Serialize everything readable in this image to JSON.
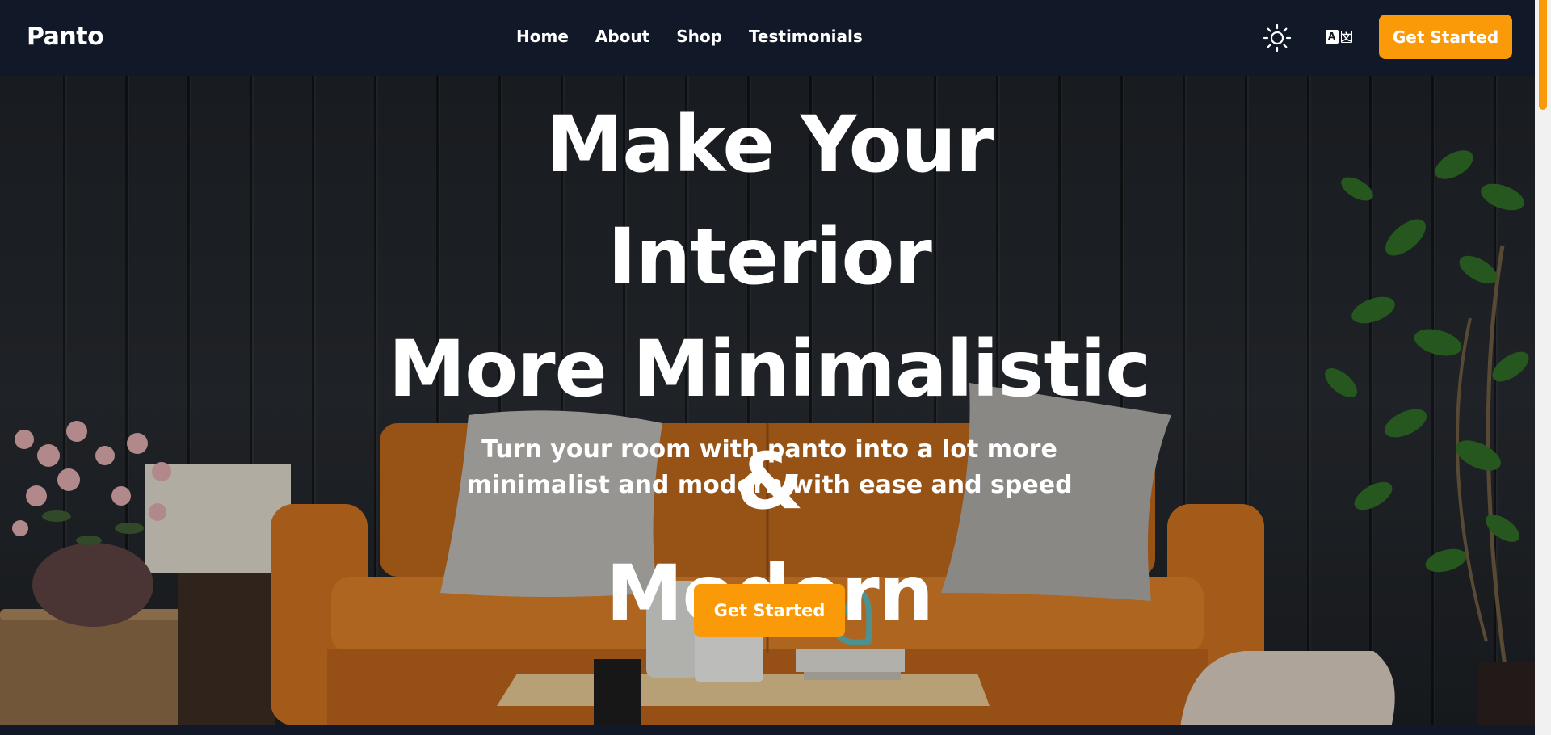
{
  "header": {
    "logo": "Panto",
    "nav": [
      {
        "label": "Home"
      },
      {
        "label": "About"
      },
      {
        "label": "Shop"
      },
      {
        "label": "Testimonials"
      }
    ],
    "theme_icon": "sun-icon",
    "lang_icon": "translate-icon",
    "lang_glyphs": [
      "A",
      "文"
    ],
    "cta_label": "Get Started"
  },
  "hero": {
    "title_lines": [
      "Make Your Interior",
      "More Minimalistic &",
      "Modern"
    ],
    "subtitle": "Turn your room with panto into a lot more minimalist and modern with ease and speed",
    "cta_label": "Get Started"
  },
  "colors": {
    "accent": "#fb9a08",
    "header_bg": "#111827",
    "sofa": "#c8701f",
    "wall": "#24282d"
  }
}
